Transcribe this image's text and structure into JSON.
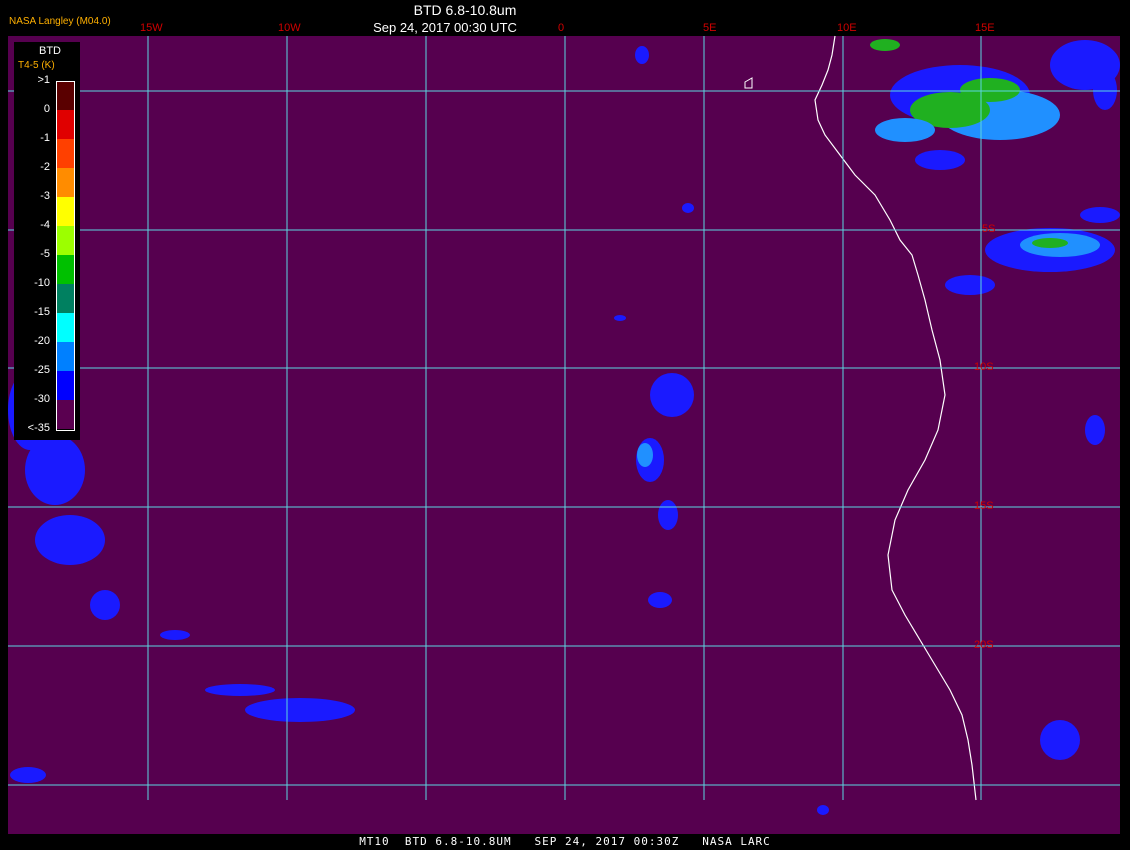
{
  "header": {
    "title": "BTD 6.8-10.8um",
    "date": "Sep 24, 2017 00:30 UTC",
    "source": "NASA Langley (M04.0)"
  },
  "footer": {
    "text": "MT10  BTD 6.8-10.8UM   SEP 24, 2017 00:30Z   NASA LARC"
  },
  "longitude_labels": [
    "15W",
    "10W",
    "0",
    "5E",
    "10E",
    "15E"
  ],
  "latitude_labels": [
    "5S",
    "10S",
    "15S",
    "20S"
  ],
  "legend": {
    "title": "BTD",
    "subtitle": "T4-5 (K)",
    "labels": [
      ">1",
      "0",
      "-1",
      "-2",
      "-3",
      "-4",
      "-5",
      "-10",
      "-15",
      "-20",
      "-25",
      "-30",
      "<-35"
    ],
    "colors": [
      "#5a0000",
      "#e00000",
      "#ff4000",
      "#ff8c00",
      "#ffff00",
      "#9cff00",
      "#00c000",
      "#008060",
      "#00ffff",
      "#0080ff",
      "#0000ff",
      "#5a0050"
    ]
  },
  "colors": {
    "ocean": "#56004f",
    "grid": "#5cd6e0",
    "coast": "#ffffff",
    "cloud_blue": "#1a1aff",
    "cloud_cyan": "#2090ff",
    "cloud_green": "#20b020"
  }
}
